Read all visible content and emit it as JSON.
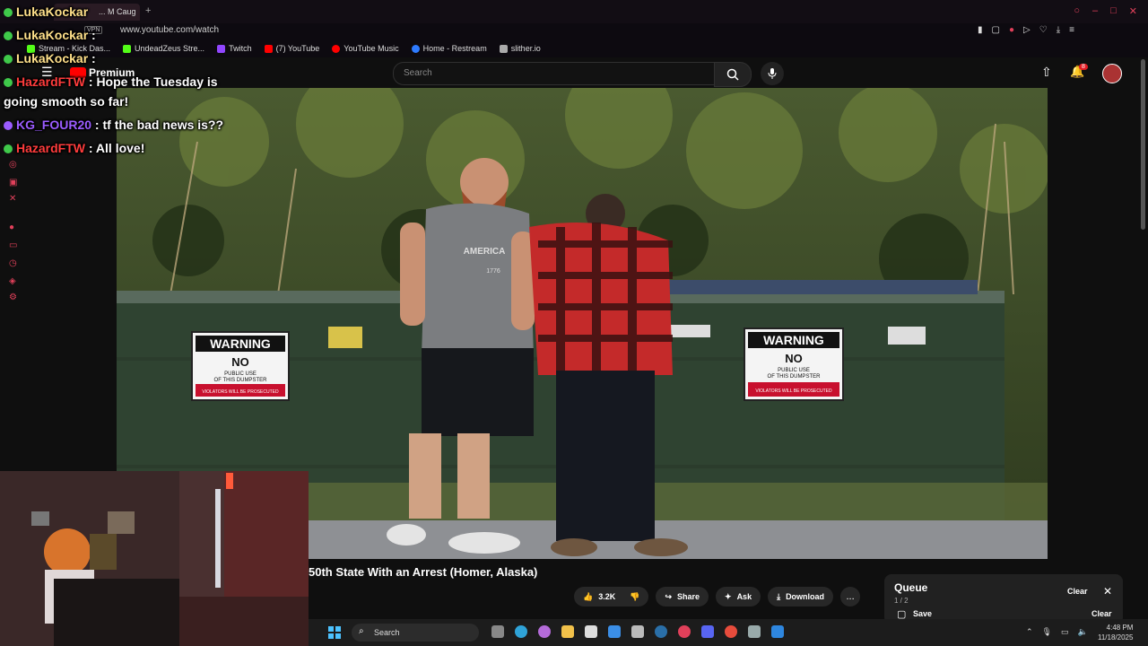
{
  "browser": {
    "tab_label": "... M Caug",
    "new_tab": "+",
    "vpn": "VPN",
    "url": "www.youtube.com/watch",
    "window_controls": [
      "○",
      "–",
      "□",
      "✕"
    ],
    "bookmarks": [
      {
        "label": "Stream - Kick Das...",
        "color": "#53fc18"
      },
      {
        "label": "UndeadZeus Stre...",
        "color": "#53fc18"
      },
      {
        "label": "Twitch",
        "color": "#9146ff"
      },
      {
        "label": "(7) YouTube",
        "color": "#ff0000"
      },
      {
        "label": "YouTube Music",
        "color": "#ff0000"
      },
      {
        "label": "Home - Restream",
        "color": "#2e7bff"
      },
      {
        "label": "slither.io",
        "color": "#aaaaaa"
      }
    ]
  },
  "youtube": {
    "logo_text": "Premium",
    "search_placeholder": "Search",
    "notification_count": "8",
    "video_title": "50th State With an Arrest (Homer, Alaska)",
    "actions": {
      "likes": "3.2K",
      "share": "Share",
      "ask": "Ask",
      "download": "Download",
      "more": "..."
    },
    "queue": {
      "title": "Queue",
      "count": "1 / 2",
      "clear": "Clear",
      "save": "Save",
      "clear2": "Clear"
    }
  },
  "chat": [
    {
      "user": "LukaKockar",
      "message": "",
      "color": "#ffe08a"
    },
    {
      "user": "LukaKockar",
      "message": "",
      "color": "#ffe08a"
    },
    {
      "user": "LukaKockar",
      "message": "",
      "color": "#ffe08a"
    },
    {
      "user": "HazardFTW",
      "message": ": Hope the Tuesday is",
      "message_cont": "going smooth so far!",
      "color": "#ff3c3c"
    },
    {
      "user": "KG_FOUR20",
      "message": ": tf the bad news is??",
      "color": "#9b5cff"
    },
    {
      "user": "HazardFTW",
      "message": ": All love!",
      "color": "#ff3c3c"
    }
  ],
  "video_scene": {
    "signs": [
      {
        "heading": "WARNING",
        "line1": "NO",
        "line2": "PUBLIC USE",
        "line3": "OF THIS DUMPSTER",
        "footer": "VIOLATORS WILL BE PROSECUTED"
      },
      {
        "heading": "WARNING",
        "line1": "NO",
        "line2": "PUBLIC USE",
        "line3": "OF THIS DUMPSTER",
        "footer": "VIOLATORS WILL BE PROSECUTED"
      }
    ],
    "shirt_text": "AMERICA",
    "shirt_year": "1776"
  },
  "taskbar": {
    "search_label": "Search",
    "time": "4:48 PM",
    "date": "11/18/2025"
  }
}
